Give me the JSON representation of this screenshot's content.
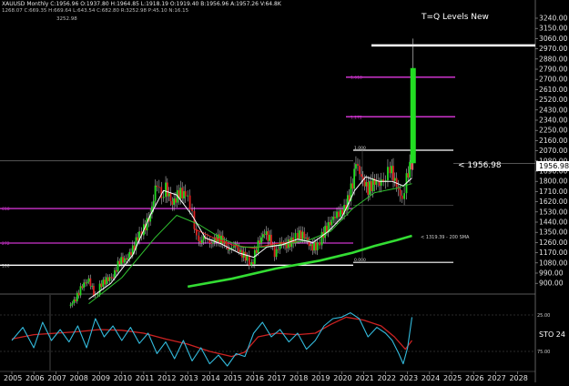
{
  "header": {
    "symbol_line": "XAUUSD Monthly C:1956.96 O:1937.80 H:1964.85 L:1918.19 O:1919.40 B:1956.96 A:1957.26 V:64.8K",
    "sub_line": "1268.07 C:669.35 H:669.64 L:643.54 C:682.80 R:3252.98 P:45.10 N:16.15",
    "marker_value": "3252.98"
  },
  "chart_title": "T=Q Levels New",
  "current_price": "1956.98",
  "current_price_label": "< 1956.98",
  "sma_label": "< 1319.39 - 200 SMA",
  "sto_label": "STO 24",
  "fib_labels": {
    "l1618": "1.618",
    "l1272": "1.272",
    "l1": "1.000",
    "l0": "0.000",
    "m618": "618",
    "m272": "272",
    "m100": "100",
    "m000": "0.000"
  },
  "osc_labels": {
    "o25": "25.00",
    "o75": "75.00"
  },
  "colors": {
    "up": "#22dd22",
    "down": "#dd2222",
    "fib": "#cc33cc",
    "sma": "#33dd33",
    "k_line": "#33bbdd",
    "d_line": "#cc2222",
    "white": "#ffffff"
  },
  "chart_data": {
    "type": "candlestick",
    "y_axis_ticks": [
      "3240.00",
      "3150.00",
      "3060.00",
      "2970.00",
      "2880.00",
      "2790.00",
      "2700.00",
      "2610.00",
      "2520.00",
      "2430.00",
      "2340.00",
      "2250.00",
      "2160.00",
      "2070.00",
      "1980.00",
      "1890.00",
      "1800.00",
      "1710.00",
      "1620.00",
      "1530.00",
      "1440.00",
      "1350.00",
      "1260.00",
      "1170.00",
      "1080.00",
      "990.00",
      "900.00"
    ],
    "x_axis_ticks": [
      "2005",
      "2006",
      "2007",
      "2008",
      "2009",
      "2010",
      "2011",
      "2012",
      "2013",
      "2014",
      "2015",
      "2016",
      "2017",
      "2018",
      "2019",
      "2020",
      "2021",
      "2022",
      "2023",
      "2024",
      "2025",
      "2026",
      "2027",
      "2028"
    ],
    "ylim": [
      860,
      3260
    ],
    "xlim": [
      2005.0,
      2028.5
    ],
    "levels": [
      {
        "name": "top",
        "value": 3000
      },
      {
        "name": "1.618",
        "value": 2720
      },
      {
        "name": "1.272",
        "value": 2370
      },
      {
        "name": "1.000",
        "value": 2075
      },
      {
        "name": "618",
        "value": 1560
      },
      {
        "name": "272",
        "value": 1255
      },
      {
        "name": "0.000",
        "value": 1060
      }
    ],
    "price_path": [
      [
        2007.6,
        700
      ],
      [
        2007.9,
        760
      ],
      [
        2008.2,
        880
      ],
      [
        2008.5,
        930
      ],
      [
        2008.8,
        780
      ],
      [
        2009.0,
        880
      ],
      [
        2009.3,
        930
      ],
      [
        2009.6,
        960
      ],
      [
        2009.9,
        1100
      ],
      [
        2010.2,
        1110
      ],
      [
        2010.5,
        1200
      ],
      [
        2010.8,
        1340
      ],
      [
        2011.0,
        1380
      ],
      [
        2011.3,
        1500
      ],
      [
        2011.6,
        1800
      ],
      [
        2011.8,
        1650
      ],
      [
        2012.0,
        1740
      ],
      [
        2012.3,
        1600
      ],
      [
        2012.6,
        1700
      ],
      [
        2012.9,
        1680
      ],
      [
        2013.1,
        1600
      ],
      [
        2013.3,
        1400
      ],
      [
        2013.5,
        1250
      ],
      [
        2013.8,
        1320
      ],
      [
        2014.0,
        1240
      ],
      [
        2014.3,
        1300
      ],
      [
        2014.6,
        1280
      ],
      [
        2014.9,
        1180
      ],
      [
        2015.1,
        1250
      ],
      [
        2015.4,
        1170
      ],
      [
        2015.7,
        1120
      ],
      [
        2015.9,
        1060
      ],
      [
        2016.2,
        1250
      ],
      [
        2016.5,
        1350
      ],
      [
        2016.8,
        1270
      ],
      [
        2016.95,
        1150
      ],
      [
        2017.2,
        1250
      ],
      [
        2017.5,
        1240
      ],
      [
        2017.8,
        1280
      ],
      [
        2018.0,
        1330
      ],
      [
        2018.3,
        1320
      ],
      [
        2018.6,
        1220
      ],
      [
        2018.9,
        1230
      ],
      [
        2019.1,
        1320
      ],
      [
        2019.4,
        1410
      ],
      [
        2019.7,
        1500
      ],
      [
        2019.95,
        1520
      ],
      [
        2020.2,
        1580
      ],
      [
        2020.5,
        1780
      ],
      [
        2020.65,
        1970
      ],
      [
        2020.9,
        1830
      ],
      [
        2021.2,
        1730
      ],
      [
        2021.5,
        1800
      ],
      [
        2021.8,
        1780
      ],
      [
        2022.0,
        1830
      ],
      [
        2022.2,
        1930
      ],
      [
        2022.5,
        1760
      ],
      [
        2022.75,
        1640
      ],
      [
        2022.95,
        1820
      ],
      [
        2023.1,
        1940
      ],
      [
        2023.2,
        1956.98
      ],
      [
        2023.25,
        2800
      ]
    ],
    "sma200": [
      [
        2013.0,
        870
      ],
      [
        2015.0,
        940
      ],
      [
        2017.0,
        1030
      ],
      [
        2019.0,
        1100
      ],
      [
        2020.5,
        1170
      ],
      [
        2021.5,
        1230
      ],
      [
        2022.5,
        1280
      ],
      [
        2023.2,
        1319.39
      ]
    ],
    "sma_fast_white": [
      [
        2008.5,
        760
      ],
      [
        2009.5,
        900
      ],
      [
        2010.5,
        1150
      ],
      [
        2011.3,
        1500
      ],
      [
        2011.9,
        1720
      ],
      [
        2012.5,
        1680
      ],
      [
        2013.2,
        1500
      ],
      [
        2013.8,
        1300
      ],
      [
        2014.5,
        1250
      ],
      [
        2015.3,
        1170
      ],
      [
        2016.0,
        1130
      ],
      [
        2016.6,
        1220
      ],
      [
        2017.3,
        1240
      ],
      [
        2018.0,
        1290
      ],
      [
        2018.7,
        1260
      ],
      [
        2019.4,
        1360
      ],
      [
        2020.0,
        1480
      ],
      [
        2020.6,
        1720
      ],
      [
        2021.1,
        1840
      ],
      [
        2021.7,
        1800
      ],
      [
        2022.3,
        1800
      ],
      [
        2022.8,
        1760
      ],
      [
        2023.2,
        1830
      ]
    ],
    "sma_mid_green": [
      [
        2008.5,
        720
      ],
      [
        2010.0,
        950
      ],
      [
        2011.5,
        1300
      ],
      [
        2012.5,
        1500
      ],
      [
        2013.5,
        1420
      ],
      [
        2014.5,
        1300
      ],
      [
        2015.5,
        1220
      ],
      [
        2016.5,
        1220
      ],
      [
        2017.5,
        1250
      ],
      [
        2018.5,
        1280
      ],
      [
        2019.5,
        1360
      ],
      [
        2020.5,
        1560
      ],
      [
        2021.5,
        1700
      ],
      [
        2022.5,
        1740
      ],
      [
        2023.2,
        1780
      ]
    ],
    "sma_red": [
      [
        2013.3,
        1380
      ],
      [
        2014.2,
        1300
      ],
      [
        2015.0,
        1240
      ],
      [
        2016.0,
        1210
      ],
      [
        2017.0,
        1250
      ],
      [
        2018.0,
        1270
      ]
    ],
    "oscillator": {
      "k": [
        [
          2005.0,
          60
        ],
        [
          2005.5,
          42
        ],
        [
          2006.0,
          70
        ],
        [
          2006.4,
          35
        ],
        [
          2006.8,
          60
        ],
        [
          2007.2,
          45
        ],
        [
          2007.6,
          62
        ],
        [
          2008.0,
          40
        ],
        [
          2008.4,
          70
        ],
        [
          2008.8,
          30
        ],
        [
          2009.2,
          55
        ],
        [
          2009.6,
          40
        ],
        [
          2010.0,
          60
        ],
        [
          2010.4,
          42
        ],
        [
          2010.8,
          64
        ],
        [
          2011.2,
          50
        ],
        [
          2011.6,
          78
        ],
        [
          2012.0,
          62
        ],
        [
          2012.4,
          85
        ],
        [
          2012.8,
          60
        ],
        [
          2013.2,
          88
        ],
        [
          2013.6,
          70
        ],
        [
          2014.0,
          92
        ],
        [
          2014.4,
          80
        ],
        [
          2014.8,
          95
        ],
        [
          2015.2,
          78
        ],
        [
          2015.6,
          82
        ],
        [
          2016.0,
          50
        ],
        [
          2016.4,
          35
        ],
        [
          2016.8,
          55
        ],
        [
          2017.2,
          45
        ],
        [
          2017.6,
          62
        ],
        [
          2018.0,
          50
        ],
        [
          2018.4,
          72
        ],
        [
          2018.8,
          60
        ],
        [
          2019.2,
          40
        ],
        [
          2019.6,
          30
        ],
        [
          2020.0,
          28
        ],
        [
          2020.4,
          22
        ],
        [
          2020.8,
          30
        ],
        [
          2021.2,
          55
        ],
        [
          2021.6,
          42
        ],
        [
          2022.0,
          50
        ],
        [
          2022.3,
          60
        ],
        [
          2022.6,
          78
        ],
        [
          2022.8,
          92
        ],
        [
          2023.0,
          70
        ],
        [
          2023.2,
          28
        ]
      ],
      "d": [
        [
          2005.0,
          58
        ],
        [
          2006.0,
          52
        ],
        [
          2007.0,
          50
        ],
        [
          2008.0,
          48
        ],
        [
          2009.0,
          45
        ],
        [
          2010.0,
          46
        ],
        [
          2011.0,
          50
        ],
        [
          2012.0,
          58
        ],
        [
          2013.0,
          65
        ],
        [
          2014.0,
          75
        ],
        [
          2015.0,
          82
        ],
        [
          2015.6,
          76
        ],
        [
          2016.2,
          55
        ],
        [
          2017.0,
          50
        ],
        [
          2018.0,
          52
        ],
        [
          2018.8,
          50
        ],
        [
          2019.5,
          38
        ],
        [
          2020.2,
          28
        ],
        [
          2021.0,
          32
        ],
        [
          2021.8,
          40
        ],
        [
          2022.4,
          55
        ],
        [
          2022.9,
          72
        ],
        [
          2023.2,
          60
        ]
      ]
    }
  }
}
